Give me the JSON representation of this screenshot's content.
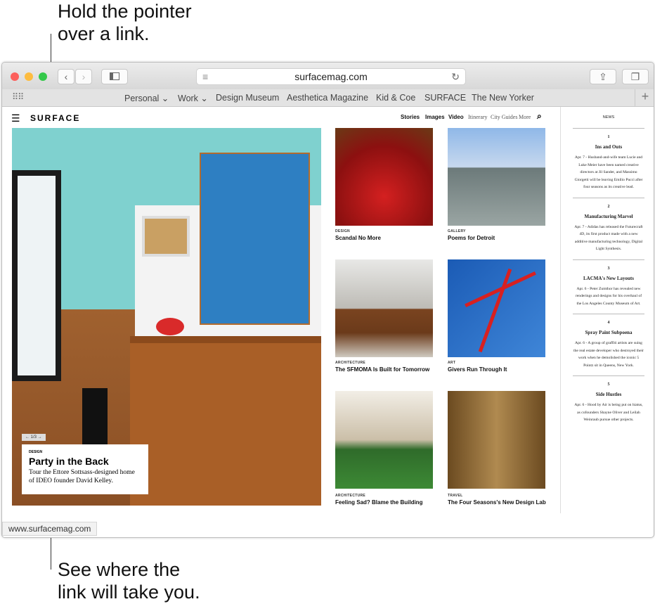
{
  "callouts": {
    "top_line1": "Hold the pointer",
    "top_line2": "over a link.",
    "bottom_line1": "See where the",
    "bottom_line2": "link will take you."
  },
  "toolbar": {
    "url": "surfacemag.com",
    "back": "‹",
    "forward": "›"
  },
  "bookmarks": [
    "Personal ⌄",
    "Work ⌄",
    "Design Museum",
    "Aesthetica Magazine",
    "Kid & Coe",
    "SURFACE",
    "The New Yorker"
  ],
  "site": {
    "logo": "SURFACE",
    "nav": [
      "Stories",
      "Images",
      "Video",
      "Itinerary",
      "City Guides",
      "More"
    ]
  },
  "hero": {
    "pager": "← 1/3 →",
    "category": "DESIGN",
    "title": "Party in the Back",
    "desc": "Tour the Ettore Sottsass-designed home of IDEO founder David Kelley."
  },
  "articles": [
    {
      "category": "DESIGN",
      "title": "Scandal No More"
    },
    {
      "category": "GALLERY",
      "title": "Poems for Detroit"
    },
    {
      "category": "ARCHITECTURE",
      "title": "The SFMOMA Is Built for Tomorrow"
    },
    {
      "category": "ART",
      "title": "Givers Run Through It"
    },
    {
      "category": "ARCHITECTURE",
      "title": "Feeling Sad? Blame the Building"
    },
    {
      "category": "TRAVEL",
      "title": "The Four Seasons's New Design Lab"
    }
  ],
  "news": {
    "label": "NEWS",
    "items": [
      {
        "n": "1",
        "title": "Ins and Outs",
        "body": "Apr. 7 - Husband-and-wife team Lucie and Luke Meier have been named creative directors at Jil Sander, and Massimo Giorgetti will be leaving Emilio Pucci after four seasons as its creative lead."
      },
      {
        "n": "2",
        "title": "Manufacturing Marvel",
        "body": "Apr. 7 - Adidas has released the Futurecraft 4D, its first product made with a new additive manufacturing technology, Digital Light Synthesis."
      },
      {
        "n": "3",
        "title": "LACMA's New Layouts",
        "body": "Apr. 6 - Peter Zumthor has revealed new renderings and designs for his overhaul of the Los Angeles County Museum of Art."
      },
      {
        "n": "4",
        "title": "Spray Paint Subpoena",
        "body": "Apr. 6 - A group of graffiti artists are suing the real estate developer who destroyed their work when he demolished the iconic 5 Pointz sit in Queens, New York."
      },
      {
        "n": "5",
        "title": "Side Hustles",
        "body": "Apr. 6 - Hood by Air is being put on hiatus, as cofounders Shayne Oliver and Leilah Weinraub pursue other projects."
      }
    ]
  },
  "status": {
    "link": "www.surfacemag.com"
  }
}
